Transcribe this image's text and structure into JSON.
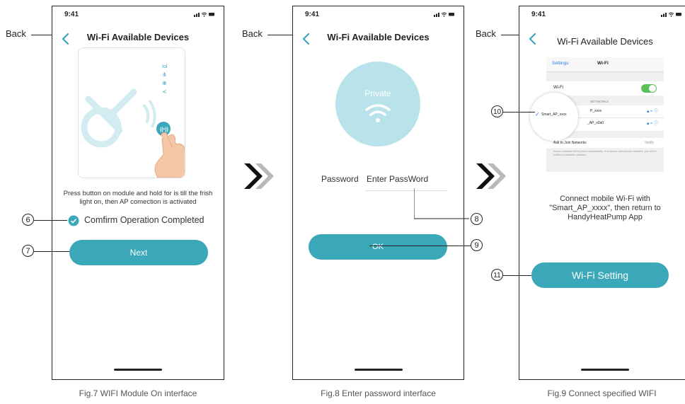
{
  "colors": {
    "accent": "#3aa8b9",
    "private_circle": "#b9e3ea",
    "ios_green": "#5cc257"
  },
  "status": {
    "time": "9:41"
  },
  "callouts": {
    "back": "Back",
    "n6": "6",
    "n7": "7",
    "n8": "8",
    "n9": "9",
    "n10": "10",
    "n11": "11"
  },
  "screen1": {
    "title": "Wi-Fi Available Devices",
    "instruction": "Press button on module and hold for is till the frish light on, then AP comection is activated",
    "checkbox_label": "Comfirm Operation Completed",
    "checkbox_checked": true,
    "next_label": "Next",
    "caption": "Fig.7 WIFI Module On interface"
  },
  "screen2": {
    "title": "Wi-Fi Available Devices",
    "network_name": "Private",
    "password_label": "Password",
    "password_placeholder": "Enter PassWord",
    "ok_label": "OK",
    "caption": "Fig.8 Enter password interface"
  },
  "screen3": {
    "title": "Wi-Fi Available Devices",
    "settings": {
      "back_label": "Settings",
      "header": "Wi-Fi",
      "wifi_row": "Wi-Fi",
      "networks_header": "NETWORKS",
      "net1": "Smart_AP_xxxx",
      "net2": "Smart_AP_x0a0",
      "net1_partial": "P_xxxx",
      "net2_partial": "_AP_x0a0",
      "ask_join": "Ask to Join Networks",
      "notify": "Notify",
      "footnote": "Known networks will be joined automatically. If no known networks are available, you will be notified of available networks."
    },
    "instruction_line1": "Connect mobile Wi-Fi with",
    "instruction_line2": "\"Smart_AP_xxxx\", then return to",
    "instruction_line3": "HandyHeatPump App",
    "wifi_setting_label": "Wi-Fi Setting",
    "caption": "Fig.9 Connect specified WIFI"
  }
}
